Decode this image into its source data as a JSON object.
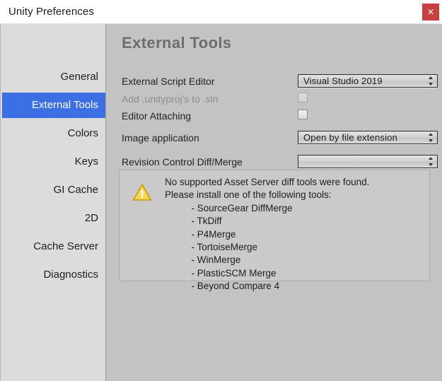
{
  "window": {
    "title": "Unity Preferences",
    "close_label": "✕",
    "close_icon": "close-icon",
    "accent_blue": "#3b6fe3",
    "close_red": "#c9413f",
    "panel_bg": "#c3c3c3",
    "sidebar_bg": "#dcdcdc"
  },
  "sidebar": {
    "items": [
      {
        "label": "General",
        "selected": false
      },
      {
        "label": "External Tools",
        "selected": true
      },
      {
        "label": "Colors",
        "selected": false
      },
      {
        "label": "Keys",
        "selected": false
      },
      {
        "label": "GI Cache",
        "selected": false
      },
      {
        "label": "2D",
        "selected": false
      },
      {
        "label": "Cache Server",
        "selected": false
      },
      {
        "label": "Diagnostics",
        "selected": false
      }
    ]
  },
  "main": {
    "page_title": "External Tools",
    "fields": [
      {
        "label": "External Script Editor",
        "type": "popup",
        "value": "Visual Studio 2019",
        "disabled": false
      },
      {
        "label": "Add .unityproj's to .sln",
        "type": "checkbox",
        "checked": false,
        "disabled": true
      },
      {
        "label": "Editor Attaching",
        "type": "checkbox",
        "checked": false,
        "disabled": false
      },
      {
        "label": "Image application",
        "type": "popup",
        "value": "Open by file extension",
        "disabled": false
      },
      {
        "label": "Revision Control Diff/Merge",
        "type": "popup",
        "value": "",
        "disabled": false
      }
    ],
    "help_box": {
      "icon": "warning-triangle-icon",
      "icon_color": "#f2c230",
      "text": "No supported Asset Server diff tools were found.\nPlease install one of the following tools:\n          - SourceGear DiffMerge\n          - TkDiff\n          - P4Merge\n          - TortoiseMerge\n          - WinMerge\n          - PlasticSCM Merge\n          - Beyond Compare 4"
    }
  }
}
